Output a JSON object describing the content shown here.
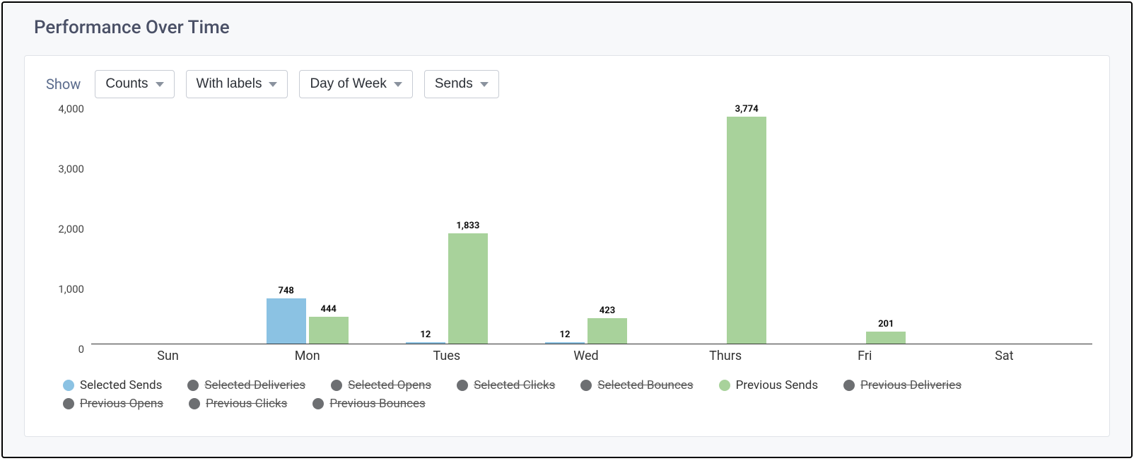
{
  "title": "Performance Over Time",
  "controls": {
    "show_label": "Show",
    "mode": "Counts",
    "labels": "With labels",
    "granularity": "Day of Week",
    "metric": "Sends"
  },
  "legend": [
    {
      "label": "Selected Sends",
      "swatch": "sel",
      "active": true
    },
    {
      "label": "Selected Deliveries",
      "swatch": "off",
      "active": false
    },
    {
      "label": "Selected Opens",
      "swatch": "off",
      "active": false
    },
    {
      "label": "Selected Clicks",
      "swatch": "off",
      "active": false
    },
    {
      "label": "Selected Bounces",
      "swatch": "off",
      "active": false
    },
    {
      "label": "Previous Sends",
      "swatch": "prev",
      "active": true
    },
    {
      "label": "Previous Deliveries",
      "swatch": "off",
      "active": false
    },
    {
      "label": "Previous Opens",
      "swatch": "off",
      "active": false
    },
    {
      "label": "Previous Clicks",
      "swatch": "off",
      "active": false
    },
    {
      "label": "Previous Bounces",
      "swatch": "off",
      "active": false
    }
  ],
  "chart_data": {
    "type": "bar",
    "title": "Performance Over Time",
    "xlabel": "",
    "ylabel": "",
    "ylim": [
      0,
      4000
    ],
    "yticks": [
      0,
      1000,
      2000,
      3000,
      4000
    ],
    "ytick_labels": [
      "0",
      "1,000",
      "2,000",
      "3,000",
      "4,000"
    ],
    "categories": [
      "Sun",
      "Mon",
      "Tues",
      "Wed",
      "Thurs",
      "Fri",
      "Sat"
    ],
    "series": [
      {
        "name": "Selected Sends",
        "color": "#8bc2e3",
        "values": [
          null,
          748,
          12,
          12,
          null,
          null,
          null
        ],
        "value_labels": [
          null,
          "748",
          "12",
          "12",
          null,
          null,
          null
        ]
      },
      {
        "name": "Previous Sends",
        "color": "#a8d29b",
        "values": [
          null,
          444,
          1833,
          423,
          3774,
          201,
          null
        ],
        "value_labels": [
          null,
          "444",
          "1,833",
          "423",
          "3,774",
          "201",
          null
        ]
      }
    ]
  }
}
